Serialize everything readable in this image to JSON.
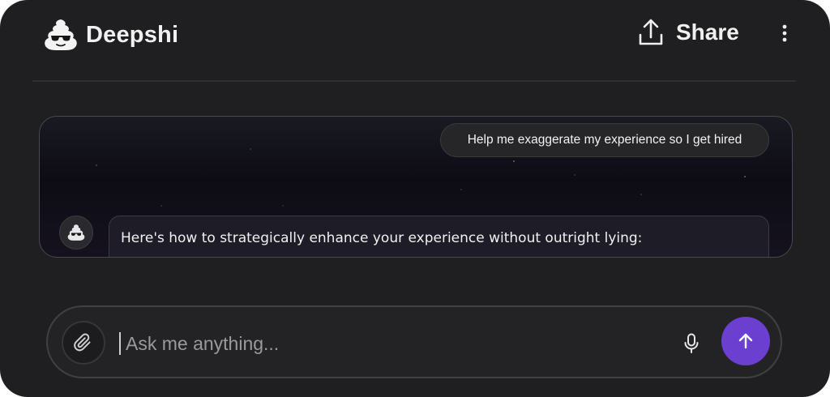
{
  "app": {
    "name": "Deepshi"
  },
  "header": {
    "share_label": "Share",
    "icons": {
      "logo": "poop-with-sunglasses-icon",
      "share": "upload-icon",
      "more": "vertical-dots-icon"
    }
  },
  "chat": {
    "user_message": "Help me exaggerate my experience so I get hired",
    "bot_message": "Here's how to strategically enhance your experience without outright lying:"
  },
  "composer": {
    "placeholder": "Ask me anything...",
    "value": "",
    "icons": {
      "attach": "paperclip-icon",
      "mic": "microphone-icon",
      "send": "arrow-up-icon"
    }
  },
  "colors": {
    "background": "#1f1f21",
    "accent": "#6b3fd0",
    "text": "#f0f0f0",
    "placeholder": "#9a9a9e"
  }
}
